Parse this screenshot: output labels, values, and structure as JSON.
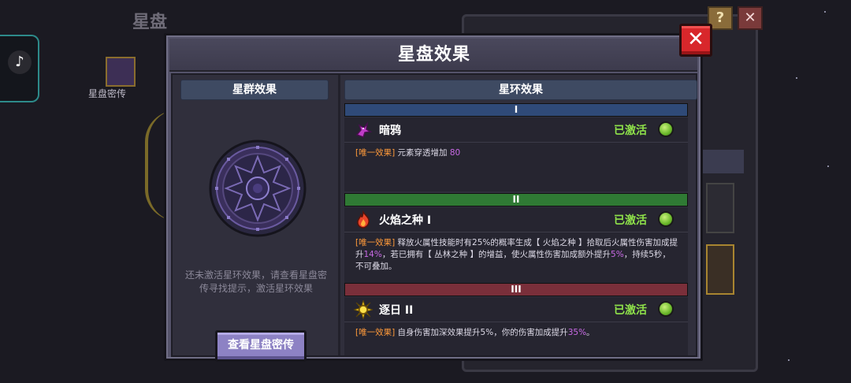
{
  "background": {
    "page_title": "星盘",
    "sidebar_item_label": "星盘密传"
  },
  "modal": {
    "title": "星盘效果",
    "close_label": "✕",
    "left": {
      "tab_label": "星群效果",
      "hint": "还未激活星环效果，请查看星盘密传寻找提示，激活星环效果",
      "button_label": "查看星盘密传"
    },
    "right": {
      "tab_label": "星环效果",
      "rings": [
        {
          "numeral": "I",
          "header_color": "#2f4a78",
          "name": "暗鸦",
          "icon": "raven-icon",
          "status": "已激活",
          "desc": [
            {
              "text": "[唯一效果] ",
              "cls": "tag"
            },
            {
              "text": "元素穿透增加 ",
              "cls": ""
            },
            {
              "text": "80",
              "cls": "hl"
            }
          ]
        },
        {
          "numeral": "II",
          "header_color": "#2f7a34",
          "name": "火焰之种 I",
          "icon": "flame-seed-icon",
          "status": "已激活",
          "desc": [
            {
              "text": "[唯一效果] ",
              "cls": "tag"
            },
            {
              "text": "释放火属性技能时有25%的概率生成【 火焰之种 】拾取后火属性伤害加成提升",
              "cls": ""
            },
            {
              "text": "14%",
              "cls": "hl"
            },
            {
              "text": "，若已拥有【 丛林之种 】的增益，使火属性伤害加成额外提升",
              "cls": ""
            },
            {
              "text": "5%",
              "cls": "hl"
            },
            {
              "text": "，持续5秒，不可叠加。",
              "cls": ""
            }
          ]
        },
        {
          "numeral": "III",
          "header_color": "#7a2f3a",
          "name": "逐日 II",
          "icon": "sun-icon",
          "status": "已激活",
          "desc": [
            {
              "text": "[唯一效果] ",
              "cls": "tag"
            },
            {
              "text": "自身伤害加深效果提升5%，你的伤害加成提升",
              "cls": ""
            },
            {
              "text": "35%",
              "cls": "hl"
            },
            {
              "text": "。",
              "cls": ""
            }
          ]
        }
      ]
    }
  }
}
